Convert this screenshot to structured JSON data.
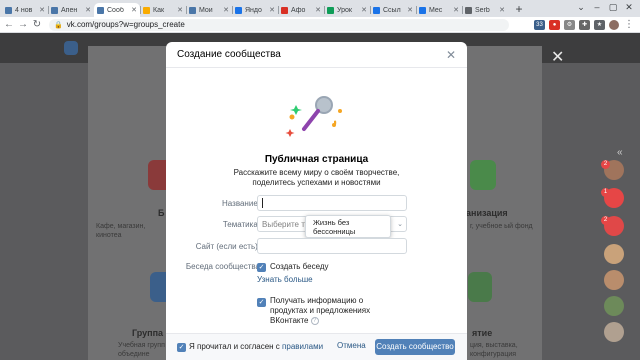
{
  "browser": {
    "tabs": [
      {
        "label": "4 нов",
        "color": "#4a76a8",
        "active": false
      },
      {
        "label": "Апен",
        "color": "#4a76a8",
        "active": false
      },
      {
        "label": "Сооб",
        "color": "#4a76a8",
        "active": true
      },
      {
        "label": "Как",
        "color": "#f9ab00",
        "active": false
      },
      {
        "label": "Мои",
        "color": "#4a76a8",
        "active": false
      },
      {
        "label": "Яндо",
        "color": "#1a73e8",
        "active": false
      },
      {
        "label": "Афо",
        "color": "#d93025",
        "active": false
      },
      {
        "label": "Урок",
        "color": "#0f9d58",
        "active": false
      },
      {
        "label": "Ссыл",
        "color": "#1a73e8",
        "active": false
      },
      {
        "label": "Мес",
        "color": "#1a73e8",
        "active": false
      },
      {
        "label": "Serb",
        "color": "#5f6368",
        "active": false
      }
    ],
    "new_tab_symbol": "+",
    "url": "vk.com/groups?w=groups_create",
    "ext_badge": "33"
  },
  "modal": {
    "title": "Создание сообщества",
    "page_type_title": "Публичная страница",
    "page_type_desc": "Расскажите всему миру о своём творчестве, поделитесь успехами и новостями",
    "name_label": "Название:",
    "topic_label": "Тематика:",
    "topic_placeholder": "Выберите тема",
    "topic_option": "Жизнь без бессонницы",
    "site_label": "Сайт (если есть):",
    "chat_label": "Беседа сообщества",
    "create_chat_label": "Создать беседу",
    "learn_more": "Узнать больше",
    "info_label": "Получать информацию о продуктах и предложениях ВКонтакте",
    "agree_prefix": "Я прочитал и согласен с",
    "agree_link": "правилами",
    "cancel": "Отмена",
    "create": "Создать сообщество"
  },
  "background": {
    "left_card_title": "Б",
    "left_card_text": "Кафе, магазин, кинотеа",
    "right_card_title": "анизация",
    "right_card_text": "г, учебное ый фонд",
    "left_card2_title": "Группа п",
    "left_card2_text": "Учебная групп объедине",
    "right_card2_title": "ятие",
    "right_card2_text": "ция, выставка, конфигурация"
  },
  "sidebar": {
    "badges": [
      "2",
      "1",
      "2"
    ]
  },
  "colors": {
    "accent": "#5181b8",
    "link": "#2a5885",
    "badge": "#e64646"
  }
}
